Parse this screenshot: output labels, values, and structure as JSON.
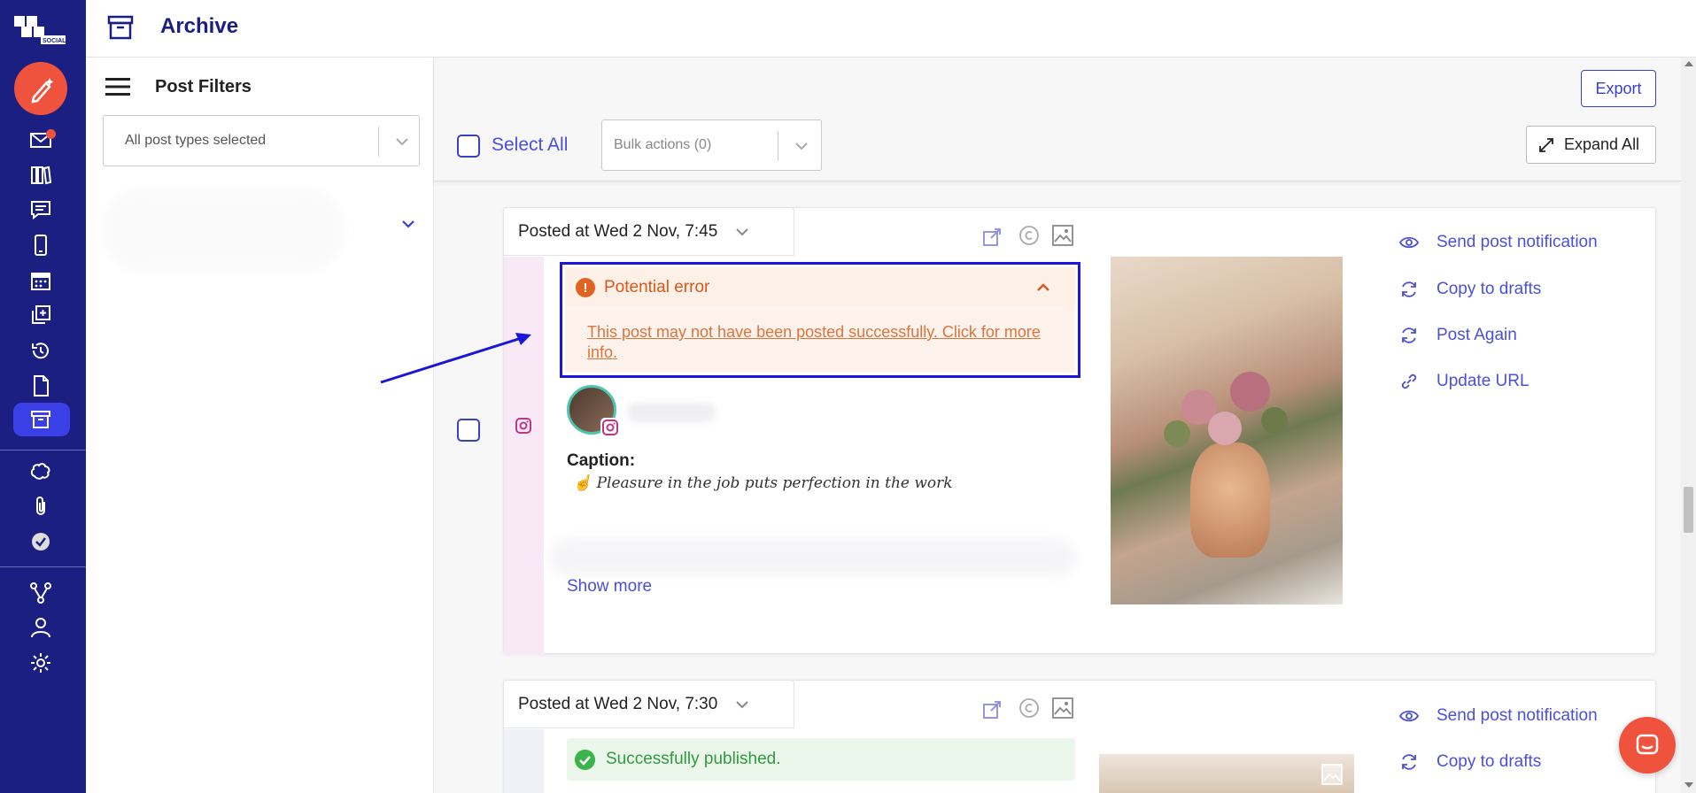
{
  "header": {
    "title": "Archive"
  },
  "filters": {
    "title": "Post Filters",
    "post_types": "All post types selected"
  },
  "toolbar": {
    "export_label": "Export",
    "select_all_label": "Select All",
    "bulk_actions": "Bulk actions (0)",
    "expand_all_label": "Expand All"
  },
  "posts": [
    {
      "posted_at": "Posted at Wed 2 Nov, 7:45",
      "status_title": "Potential error",
      "status_link": "This post may not have been posted successfully. Click for more info.",
      "caption_label": "Caption:",
      "caption_text": "Pleasure in the job puts perfection in the work",
      "show_more": "Show more",
      "actions": [
        "Send post notification",
        "Copy to drafts",
        "Post Again",
        "Update URL"
      ]
    },
    {
      "posted_at": "Posted at Wed 2 Nov, 7:30",
      "status_text": "Successfully published.",
      "actions": [
        "Send post notification",
        "Copy to drafts"
      ]
    }
  ],
  "colors": {
    "nav_bg": "#1b1f82",
    "accent": "#4b50d6",
    "brand_orange": "#f0533d",
    "error": "#d9581c",
    "success": "#2f9b3e",
    "highlight_border": "#1a16d9"
  },
  "icons": {
    "rail": [
      "logo-icon",
      "compose-icon",
      "inbox-icon",
      "library-icon",
      "comments-icon",
      "mobile-icon",
      "calendar-icon",
      "queue-icon",
      "history-icon",
      "drafts-icon",
      "archive-icon",
      "brain-icon",
      "attachments-icon",
      "approvals-icon",
      "workflow-icon",
      "user-icon",
      "settings-icon"
    ]
  }
}
